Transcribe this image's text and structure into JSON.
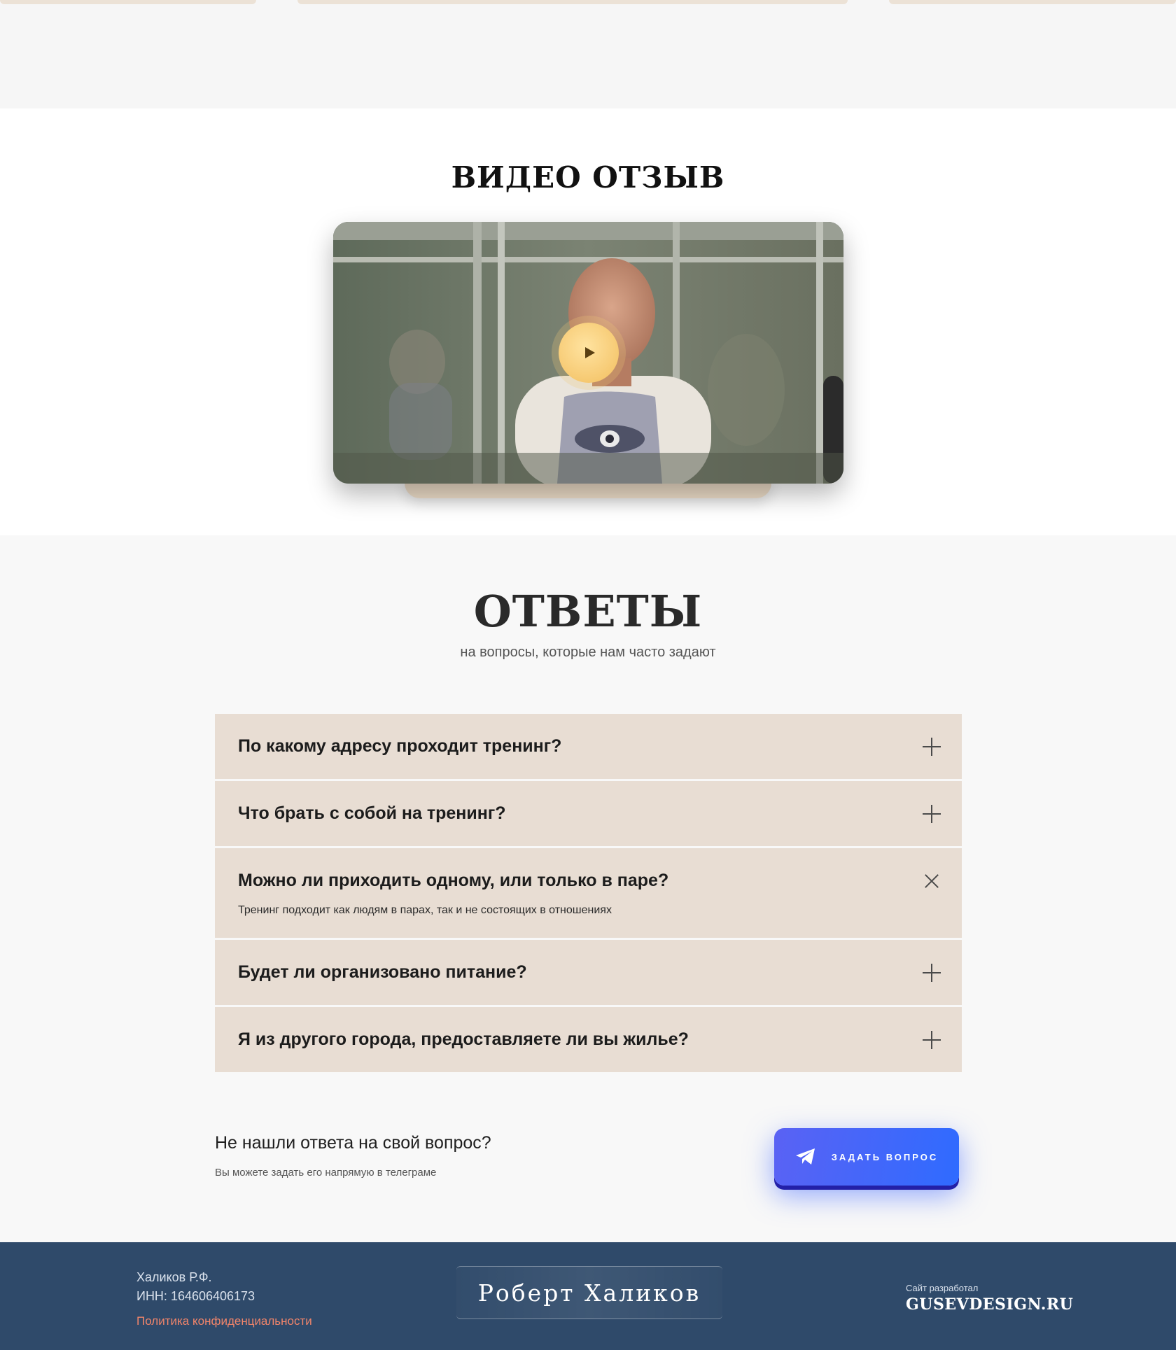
{
  "video": {
    "title": "ВИДЕО ОТЗЫВ",
    "play_icon": "play-icon"
  },
  "faq": {
    "title": "ОТВЕТЫ",
    "subtitle": "на вопросы, которые нам часто задают",
    "items": [
      {
        "question": "По какому адресу проходит тренинг?",
        "state": "collapsed",
        "icon": "plus-icon"
      },
      {
        "question": "Что брать с собой на тренинг?",
        "state": "collapsed",
        "icon": "plus-icon"
      },
      {
        "question": "Можно ли приходить одному, или только в паре?",
        "state": "expanded",
        "icon": "close-icon",
        "answer": "Тренинг подходит как людям в парах, так и не состоящих в отношениях"
      },
      {
        "question": "Будет ли организовано питание?",
        "state": "collapsed",
        "icon": "plus-icon"
      },
      {
        "question": "Я из другого города, предоставляете ли вы жилье?",
        "state": "collapsed",
        "icon": "plus-icon"
      }
    ]
  },
  "ask": {
    "title": "Не нашли ответа на свой вопрос?",
    "subtitle": "Вы можете задать его напрямую в телеграме",
    "button_label": "ЗАДАТЬ ВОПРОС",
    "button_icon": "telegram-icon"
  },
  "footer": {
    "name": "Халиков Р.Ф.",
    "inn": "ИНН: 164606406173",
    "policy_link": "Политика конфиденциальности",
    "logo_text": "Роберт Халиков",
    "dev_label": "Сайт разработал",
    "dev_name": "GUSEVDESIGN.RU"
  },
  "colors": {
    "faq_item_bg": "#e8ddd3",
    "button_accent": "#3a66ff",
    "footer_bg": "#2f4a6a",
    "policy_link": "#f2856a",
    "play_button": "#f2be5e"
  }
}
